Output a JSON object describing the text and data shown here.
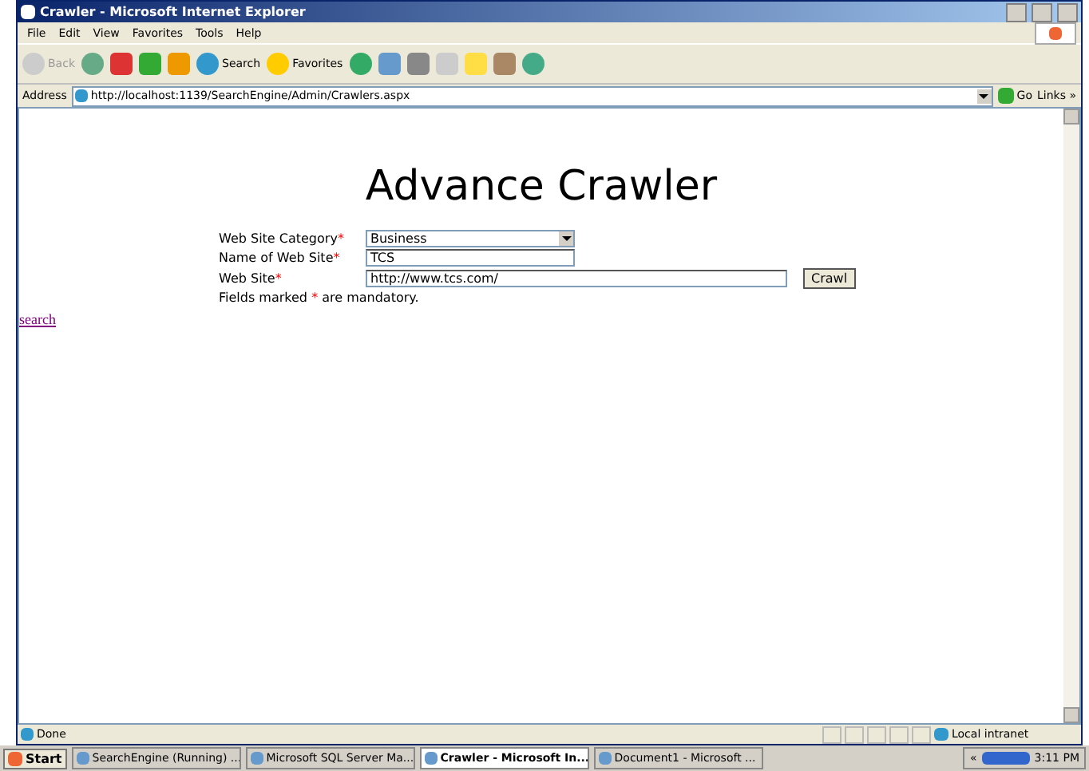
{
  "window": {
    "title": "Crawler - Microsoft Internet Explorer"
  },
  "menu": [
    "File",
    "Edit",
    "View",
    "Favorites",
    "Tools",
    "Help"
  ],
  "toolbar": [
    {
      "kind": "back",
      "label": "Back",
      "disabled": true
    },
    {
      "kind": "forward",
      "disabled": false
    },
    {
      "kind": "stop"
    },
    {
      "kind": "refresh"
    },
    {
      "kind": "home"
    },
    {
      "kind": "search",
      "label": "Search"
    },
    {
      "kind": "favorites",
      "label": "Favorites"
    },
    {
      "kind": "history"
    },
    {
      "kind": "mail"
    },
    {
      "kind": "print"
    },
    {
      "kind": "edit"
    },
    {
      "kind": "note"
    },
    {
      "kind": "research"
    },
    {
      "kind": "messenger"
    }
  ],
  "address": {
    "label": "Address",
    "url": "http://localhost:1139/SearchEngine/Admin/Crawlers.aspx",
    "go": "Go",
    "links": "Links",
    "links_chevron": "»"
  },
  "page": {
    "heading": "Advance Crawler",
    "fields": [
      {
        "kind": "select",
        "label": "Web Site Category",
        "mark": "*",
        "value": "Business"
      },
      {
        "kind": "text",
        "label": "Name of Web Site",
        "mark": "*",
        "value": "TCS"
      },
      {
        "kind": "text",
        "label": "Web Site",
        "mark": "*",
        "value": "http://www.tcs.com/",
        "button": "Crawl"
      }
    ],
    "note": {
      "before": "Fields marked",
      "mark": "*",
      "after": "are mandatory."
    },
    "link": "search"
  },
  "status_bar": {
    "text": "Done",
    "zone": "Local intranet"
  },
  "taskbar": {
    "start": "Start",
    "tasks": [
      {
        "label": "SearchEngine (Running) ...",
        "selected": false
      },
      {
        "label": "Microsoft SQL Server Ma...",
        "selected": false
      },
      {
        "label": "Crawler - Microsoft In...",
        "selected": true
      },
      {
        "label": "Document1 - Microsoft ...",
        "selected": false
      }
    ],
    "tray_toggle": "«",
    "clock": "3:11 PM"
  }
}
